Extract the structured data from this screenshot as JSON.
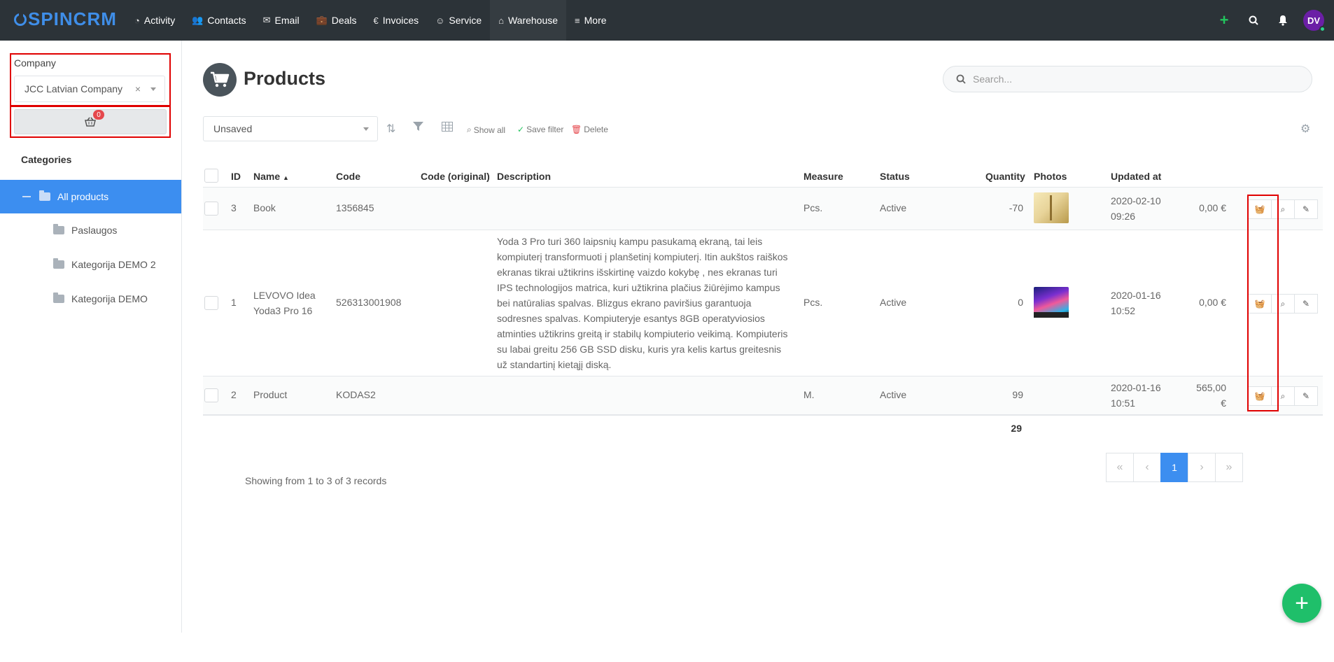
{
  "app": {
    "logo_text": "SPINCRM"
  },
  "nav": {
    "items": [
      {
        "label": "Activity",
        "icon": "gauge-icon"
      },
      {
        "label": "Contacts",
        "icon": "users-icon"
      },
      {
        "label": "Email",
        "icon": "envelope-icon"
      },
      {
        "label": "Deals",
        "icon": "briefcase-icon"
      },
      {
        "label": "Invoices",
        "icon": "euro-icon"
      },
      {
        "label": "Service",
        "icon": "support-icon"
      },
      {
        "label": "Warehouse",
        "icon": "warehouse-icon"
      },
      {
        "label": "More",
        "icon": "menu-icon"
      }
    ],
    "avatar_initials": "DV"
  },
  "sidebar": {
    "company_label": "Company",
    "company_value": "JCC Latvian Company",
    "clear_symbol": "×",
    "cart_count": "0",
    "categories_title": "Categories",
    "categories": [
      {
        "label": "All products"
      },
      {
        "label": "Paslaugos"
      },
      {
        "label": "Kategorija DEMO 2"
      },
      {
        "label": "Kategorija DEMO"
      }
    ]
  },
  "main": {
    "title": "Products",
    "search_placeholder": "Search...",
    "filter_value": "Unsaved",
    "show_all": "Show all",
    "save_filter": "Save filter",
    "delete": "Delete",
    "columns": {
      "id": "ID",
      "name": "Name",
      "code": "Code",
      "code_original": "Code (original)",
      "description": "Description",
      "measure": "Measure",
      "status": "Status",
      "quantity": "Quantity",
      "photos": "Photos",
      "updated_at": "Updated at"
    },
    "rows": [
      {
        "id": "3",
        "name": "Book",
        "code": "1356845",
        "code_original": "",
        "description": "",
        "measure": "Pcs.",
        "status": "Active",
        "quantity": "-70",
        "updated_date": "2020-02-10",
        "updated_time": "09:26",
        "price": "0,00 €"
      },
      {
        "id": "1",
        "name_line1": "LEVOVO Idea",
        "name_line2": "Yoda3 Pro 16",
        "code": "526313001908",
        "code_original": "",
        "description": "Yoda 3 Pro turi 360 laipsnių kampu pasukamą ekraną, tai leis kompiuterį transformuoti į planšetinį kompiuterį. Itin aukštos raiškos ekranas tikrai užtikrins išskirtinę vaizdo kokybę , nes ekranas turi IPS technologijos matrica, kuri užtikrina plačius žiūrėjimo kampus bei natūralias spalvas. Blizgus ekrano paviršius garantuoja sodresnes spalvas. Kompiuteryje esantys 8GB operatyviosios atminties užtikrins greitą ir stabilų kompiuterio veikimą. Kompiuteris su labai greitu 256 GB SSD disku, kuris yra kelis kartus greitesnis už standartinį kietąjį diską.",
        "measure": "Pcs.",
        "status": "Active",
        "quantity": "0",
        "updated_date": "2020-01-16",
        "updated_time": "10:52",
        "price": "0,00 €"
      },
      {
        "id": "2",
        "name": "Product",
        "code": "KODAS2",
        "code_original": "",
        "description": "",
        "measure": "M.",
        "status": "Active",
        "quantity": "99",
        "updated_date": "2020-01-16",
        "updated_time": "10:51",
        "price_line1": "565,00",
        "price_line2": "€"
      }
    ],
    "total_quantity": "29",
    "records_text": "Showing from 1 to 3 of 3 records",
    "pagination": {
      "first": "«",
      "prev": "‹",
      "current": "1",
      "next": "›",
      "last": "»"
    }
  },
  "colors": {
    "nav_bg": "#2c3338",
    "accent": "#3c8ef0",
    "highlight": "#e00000",
    "fab": "#1fbf6a",
    "badge": "#e5484d"
  }
}
